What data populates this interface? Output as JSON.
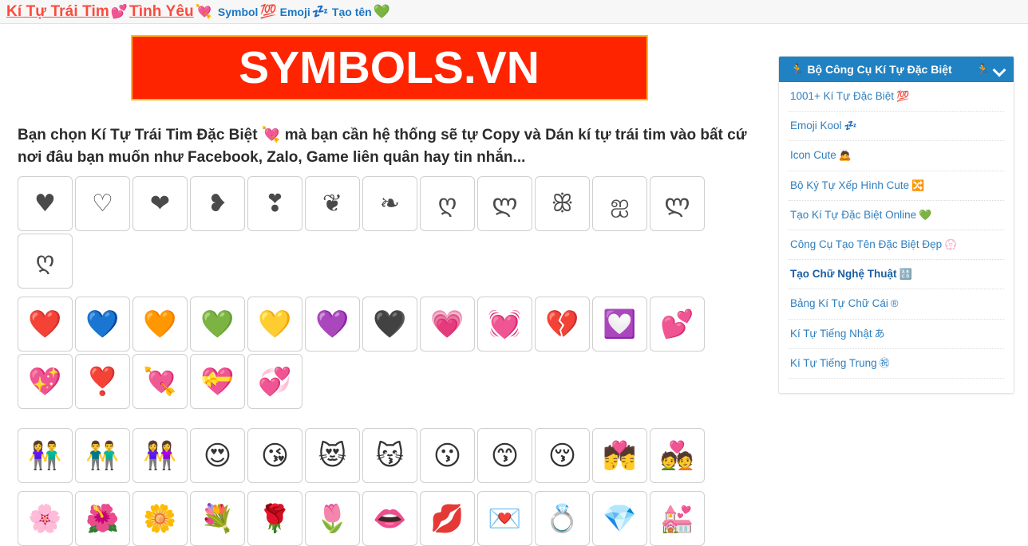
{
  "topbar": {
    "brand_part1": "Kí Tự Trái Tim",
    "brand_icon1": "💕",
    "brand_part2": "Tình Yêu",
    "brand_icon2": "💘",
    "links": [
      {
        "label": "Symbol",
        "icon": "💯"
      },
      {
        "label": "Emoji",
        "icon": "💤"
      },
      {
        "label": "Tạo tên",
        "icon": "💚"
      }
    ]
  },
  "banner": {
    "text": "SYMBOLS.VN",
    "bg_color": "#ff2400",
    "border_color": "#ffc000",
    "text_color": "#ffffff"
  },
  "intro": {
    "line1_a": "Bạn chọn Kí Tự Trái Tim Đặc Biệt ",
    "icon": "💘",
    "line1_b": " mà bạn cần hệ thống sẽ tự Copy và Dán kí tự trái tim vào bất cứ nơi đâu bạn muốn như Facebook, Zalo, Game liên quân hay tin nhắn..."
  },
  "grids": [
    {
      "name": "text-hearts",
      "kind": "text",
      "items": [
        "♥",
        "♡",
        "❤",
        "❥",
        "❣",
        "❦",
        "❧",
        "ღ",
        "ლ",
        "ꕥ",
        "ஐ",
        "ლ",
        "ღ"
      ]
    },
    {
      "name": "emoji-hearts",
      "kind": "emoji",
      "items": [
        "❤️",
        "💙",
        "🧡",
        "💚",
        "💛",
        "💜",
        "🖤",
        "💗",
        "💓",
        "💔",
        "💟",
        "💕",
        "💖",
        "❣️",
        "💘",
        "💝",
        "💞"
      ]
    },
    {
      "name": "love-people-and-faces",
      "kind": "emoji",
      "items": [
        "👫",
        "👬",
        "👭",
        "😍",
        "😘",
        "😻",
        "😽",
        "😗",
        "😙",
        "😚",
        "💏",
        "💑"
      ]
    },
    {
      "name": "love-objects",
      "kind": "emoji",
      "items": [
        "🌸",
        "🌺",
        "🌼",
        "💐",
        "🌹",
        "🌷",
        "👄",
        "💋",
        "💌",
        "💍",
        "💎",
        "💒"
      ]
    }
  ],
  "sidebar": {
    "header": {
      "icon_left": "🏃",
      "title": "Bộ Công Cụ Kí Tự Đặc Biệt",
      "icon_right": "🏃",
      "chevron": "chevron-down-icon",
      "bg_color": "#2081c3"
    },
    "items": [
      {
        "label": "1001+ Kí Tự Đặc Biệt",
        "icon": "💯",
        "bold": false
      },
      {
        "label": "Emoji Kool",
        "icon": "💤",
        "bold": false
      },
      {
        "label": "Icon Cute",
        "icon": "🙇",
        "bold": false
      },
      {
        "label": "Bộ Ký Tự Xếp Hình Cute",
        "icon": "🔀",
        "bold": false
      },
      {
        "label": "Tạo Kí Tự Đặc Biệt Online",
        "icon": "💚",
        "bold": false
      },
      {
        "label": "Công Cụ Tạo Tên Đặc Biệt Đẹp",
        "icon": "💮",
        "bold": false
      },
      {
        "label": "Tạo Chữ Nghệ Thuật",
        "icon": "🔠",
        "bold": true
      },
      {
        "label": "Bảng Kí Tự Chữ Cái",
        "icon": "®",
        "bold": false
      },
      {
        "label": "Kí Tự Tiếng Nhật",
        "icon": "あ",
        "bold": false
      },
      {
        "label": "Kí Tự Tiếng Trung",
        "icon": "㊗",
        "bold": false
      },
      {
        "label": "",
        "icon": "",
        "bold": false
      }
    ]
  }
}
